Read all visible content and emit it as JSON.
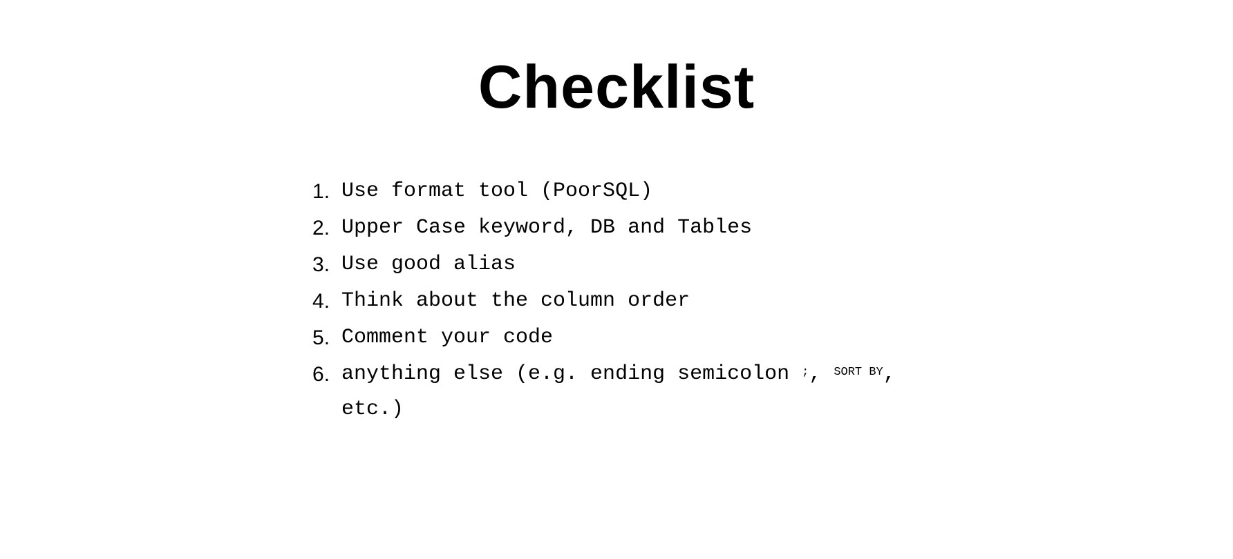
{
  "title": "Checklist",
  "items": [
    "Use format tool (PoorSQL)",
    "Upper Case keyword, DB and Tables",
    "Use good alias",
    "Think about the column order",
    "Comment your code"
  ],
  "item6": {
    "part1": "anything else (e.g. ending semicolon ",
    "code1": ";",
    "part2": ", ",
    "code2": "SORT BY",
    "part3": ", etc.)"
  }
}
